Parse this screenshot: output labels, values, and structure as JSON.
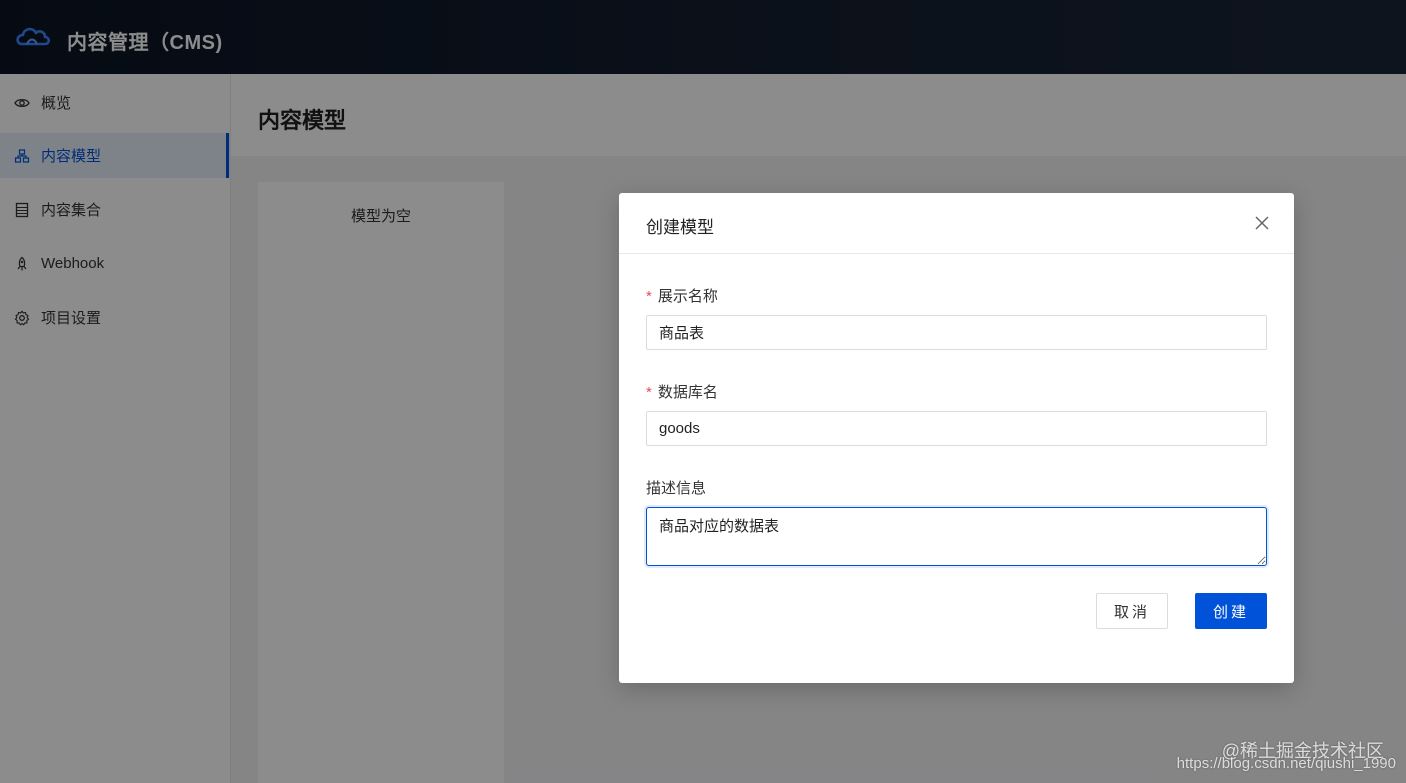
{
  "app": {
    "title": "内容管理（CMS)"
  },
  "sidebar": {
    "items": [
      {
        "label": "概览",
        "icon": "eye-icon",
        "active": false
      },
      {
        "label": "内容模型",
        "icon": "model-tree-icon",
        "active": true
      },
      {
        "label": "内容集合",
        "icon": "list-icon",
        "active": false
      },
      {
        "label": "Webhook",
        "icon": "rocket-icon",
        "active": false
      },
      {
        "label": "项目设置",
        "icon": "gear-icon",
        "active": false
      }
    ]
  },
  "main": {
    "page_title": "内容模型",
    "empty_text": "模型为空"
  },
  "modal": {
    "title": "创建模型",
    "fields": {
      "display_name": {
        "label": "展示名称",
        "required": true,
        "value": "商品表"
      },
      "db_name": {
        "label": "数据库名",
        "required": true,
        "value": "goods"
      },
      "description": {
        "label": "描述信息",
        "required": false,
        "value": "商品对应的数据表"
      }
    },
    "required_mark": "*",
    "cancel_label": "取消",
    "create_label": "创建"
  },
  "watermark": {
    "line1": "@稀土掘金技术社区",
    "line2": "https://blog.csdn.net/qiushi_1990"
  },
  "colors": {
    "accent": "#0052d9",
    "required": "#e34d59",
    "topbar": "#141e2f"
  }
}
